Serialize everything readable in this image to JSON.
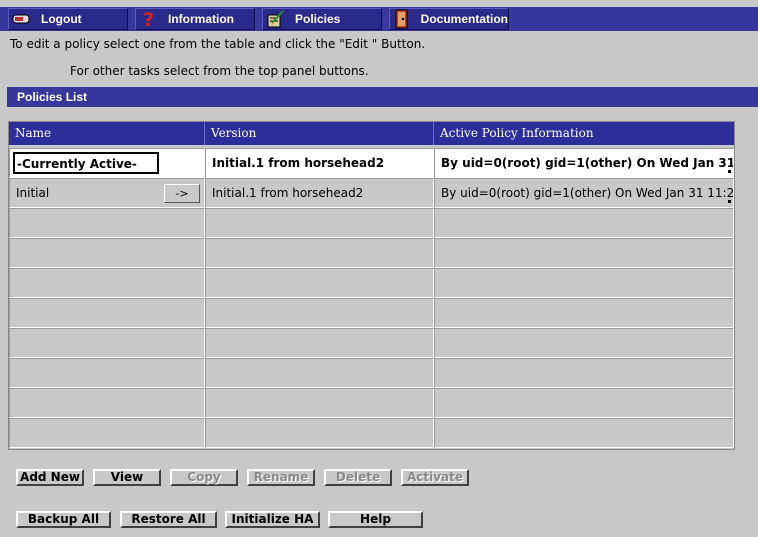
{
  "toolbar": {
    "buttons": [
      {
        "label": "Logout",
        "icon": "logout-icon"
      },
      {
        "label": "Information",
        "icon": "question-icon"
      },
      {
        "label": "Policies",
        "icon": "policies-icon"
      },
      {
        "label": "Documentation",
        "icon": "book-icon"
      }
    ]
  },
  "instructions": {
    "line1": "To edit a policy select one from the table and click the \"Edit \" Button.",
    "line2": "For other tasks select from the top panel buttons."
  },
  "section": {
    "title": "Policies List"
  },
  "table": {
    "headers": [
      "Name",
      "Version",
      "Active Policy Information"
    ],
    "rows": [
      {
        "name": "-Currently Active-",
        "version": "Initial.1  from  horsehead2",
        "info": "By uid=0(root) gid=1(other) On Wed Jan 31"
      },
      {
        "name": "Initial",
        "arrow": "->",
        "version": "Initial.1  from  horsehead2",
        "info": "By uid=0(root) gid=1(other) On Wed Jan 31 11:2"
      }
    ]
  },
  "actions": {
    "row1": [
      {
        "label": "Add New",
        "enabled": true
      },
      {
        "label": "View",
        "enabled": true
      },
      {
        "label": "Copy",
        "enabled": false
      },
      {
        "label": "Rename",
        "enabled": false
      },
      {
        "label": "Delete",
        "enabled": false
      },
      {
        "label": "Activate",
        "enabled": false
      }
    ],
    "row2": [
      {
        "label": "Backup All",
        "enabled": true
      },
      {
        "label": "Restore All",
        "enabled": true
      },
      {
        "label": "Initialize HA",
        "enabled": true
      },
      {
        "label": "Help",
        "enabled": true
      }
    ]
  },
  "colors": {
    "toolbar": "#38389c",
    "background": "#c8c8c8",
    "table_header": "#2e2e9a"
  }
}
